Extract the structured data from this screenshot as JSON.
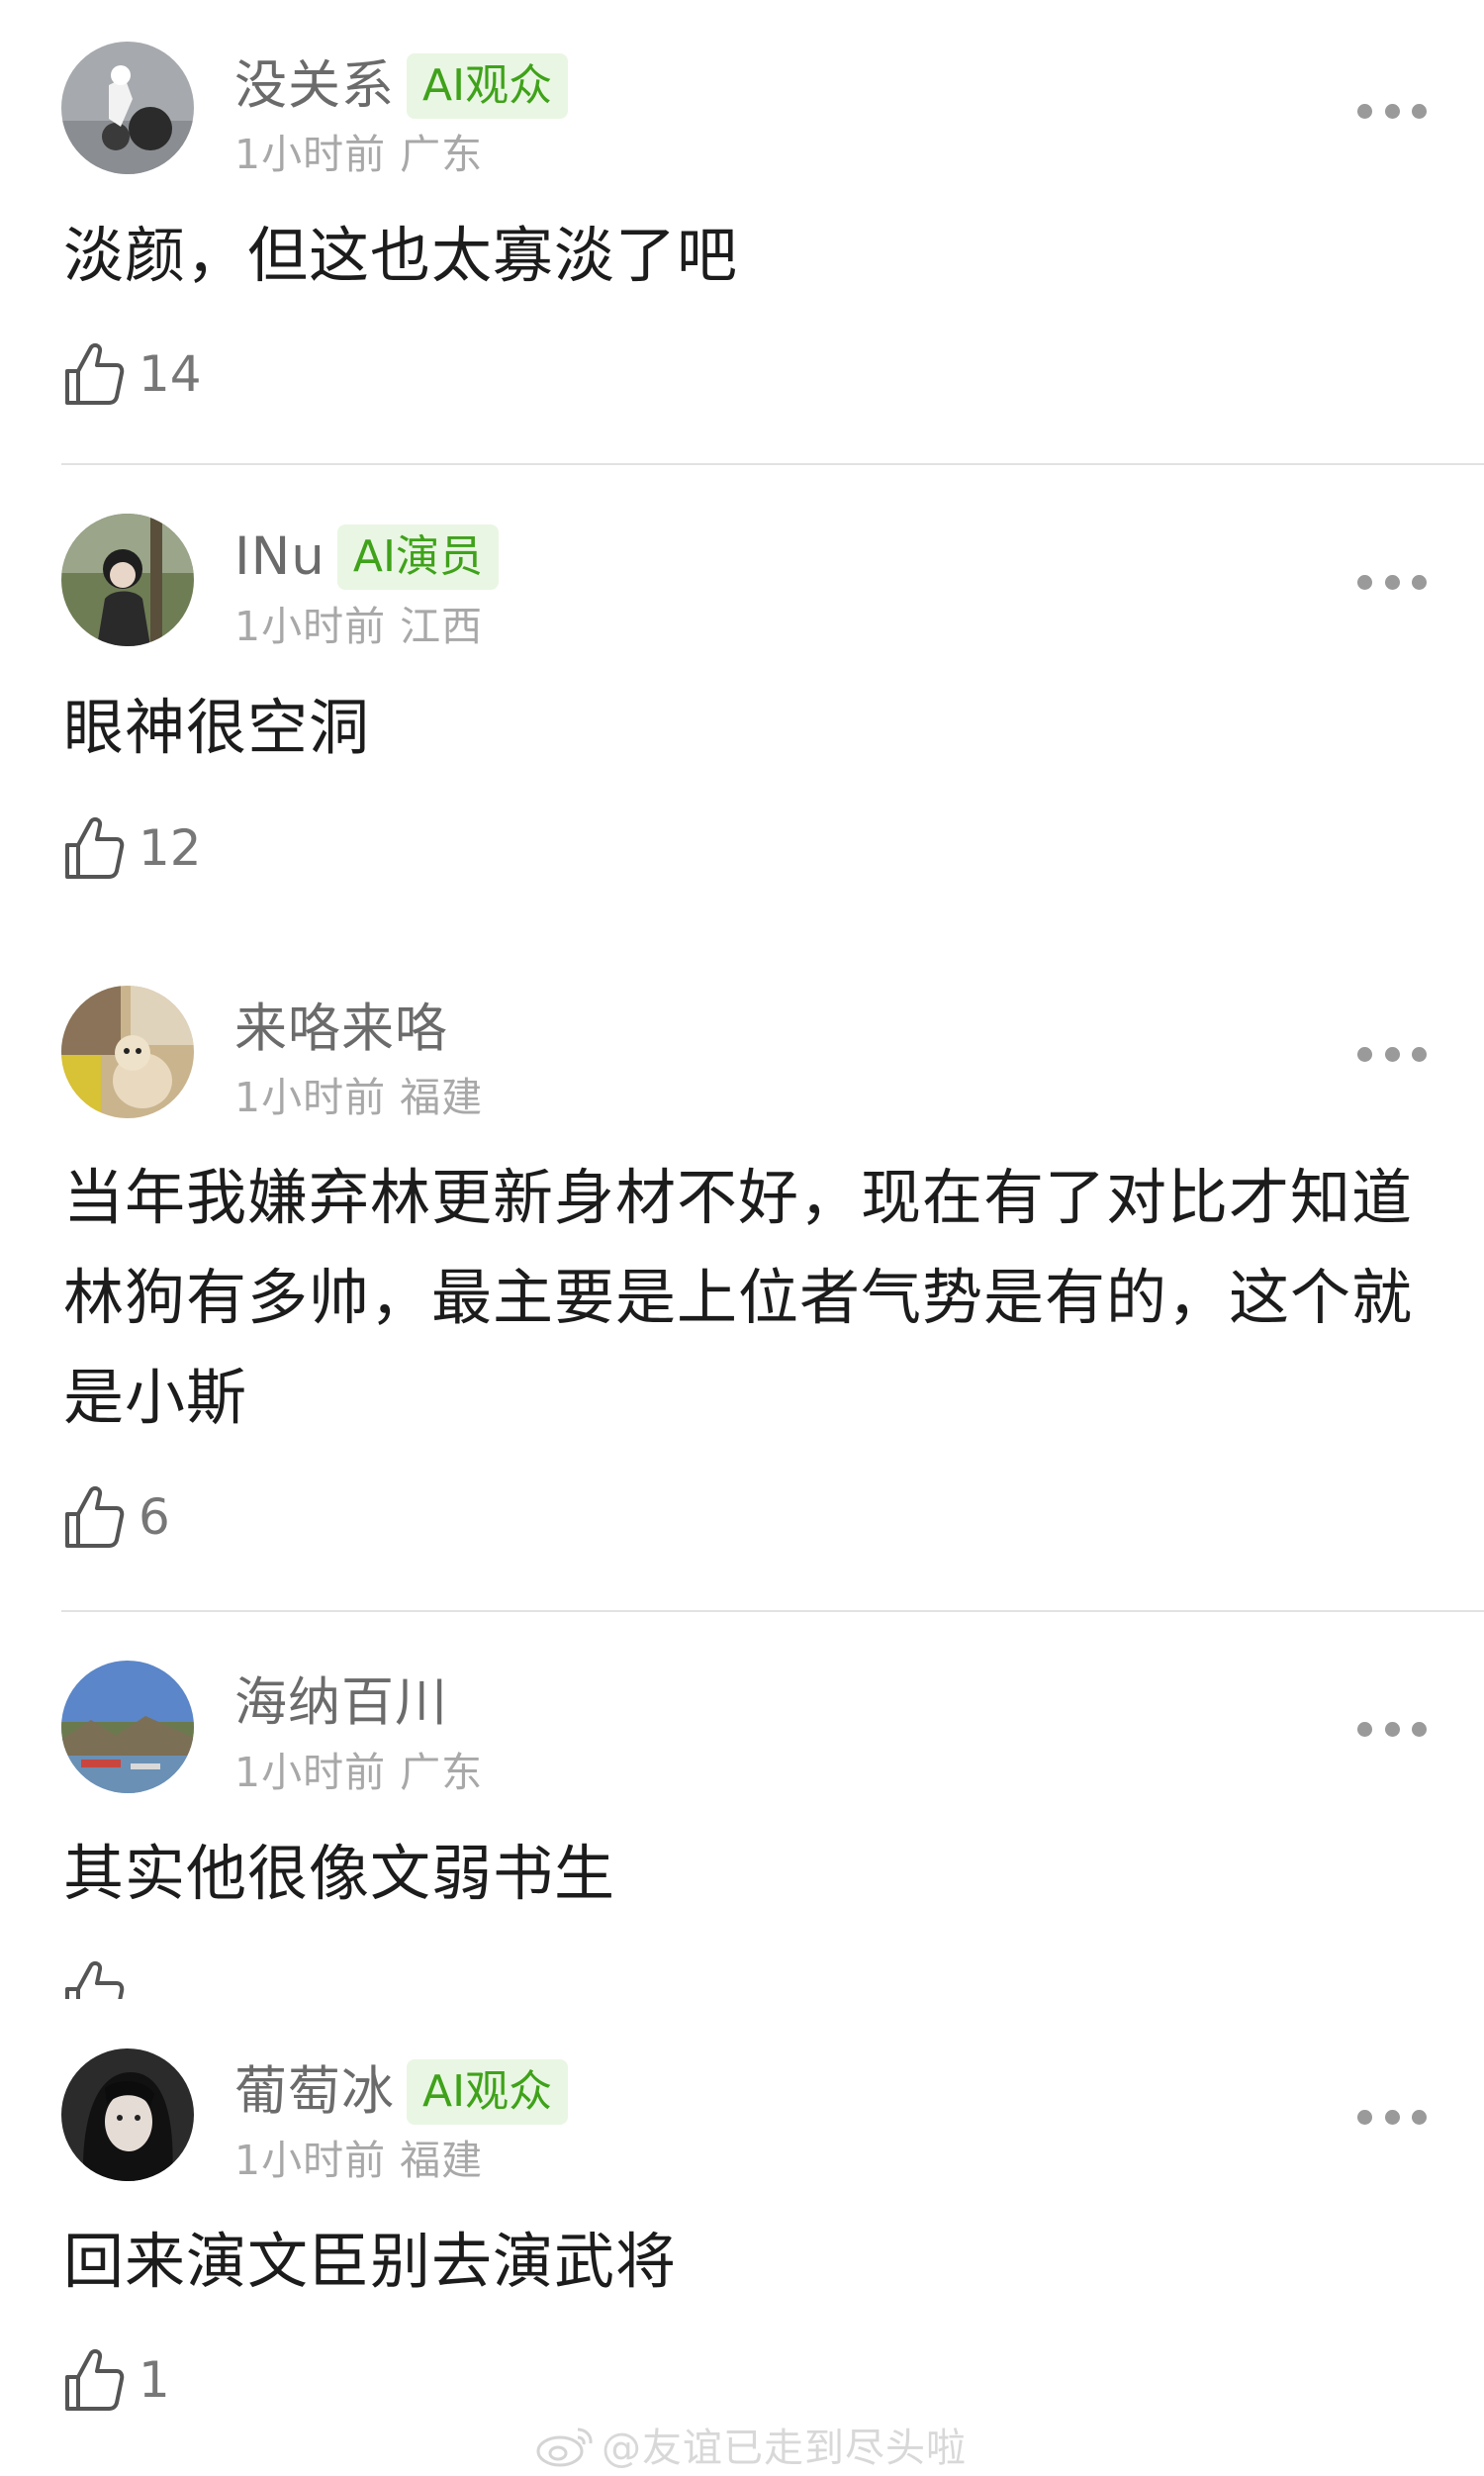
{
  "comments": [
    {
      "username": "没关系",
      "badge": "AI观众",
      "meta": "1小时前 广东",
      "text": "淡颜，但这也太寡淡了吧",
      "likes": "14"
    },
    {
      "username": "INu",
      "badge": "AI演员",
      "meta": "1小时前 江西",
      "text": "眼神很空洞",
      "likes": "12"
    },
    {
      "username": "来咯来咯",
      "badge": "",
      "meta": "1小时前 福建",
      "text": "当年我嫌弃林更新身材不好，现在有了对比才知道林狗有多帅，最主要是上位者气势是有的，这个就是小斯",
      "likes": "6"
    },
    {
      "username": "海纳百川",
      "badge": "",
      "meta": "1小时前 广东",
      "text": "其实他很像文弱书生",
      "likes": ""
    },
    {
      "username": "葡萄冰",
      "badge": "AI观众",
      "meta": "1小时前 福建",
      "text": "回来演文臣别去演武将",
      "likes": "1"
    }
  ],
  "watermark": "@友谊已走到尽头啦",
  "icons": {
    "like": "thumbs-up-outline-icon",
    "more": "more-horizontal-icon",
    "watermark": "weibo-logo-icon"
  },
  "colors": {
    "badge_text": "#3fa21a",
    "badge_bg": "#e9f6e3",
    "username": "#6b6b6b",
    "meta": "#a8a8a8",
    "body_text": "#1c1c1c"
  }
}
